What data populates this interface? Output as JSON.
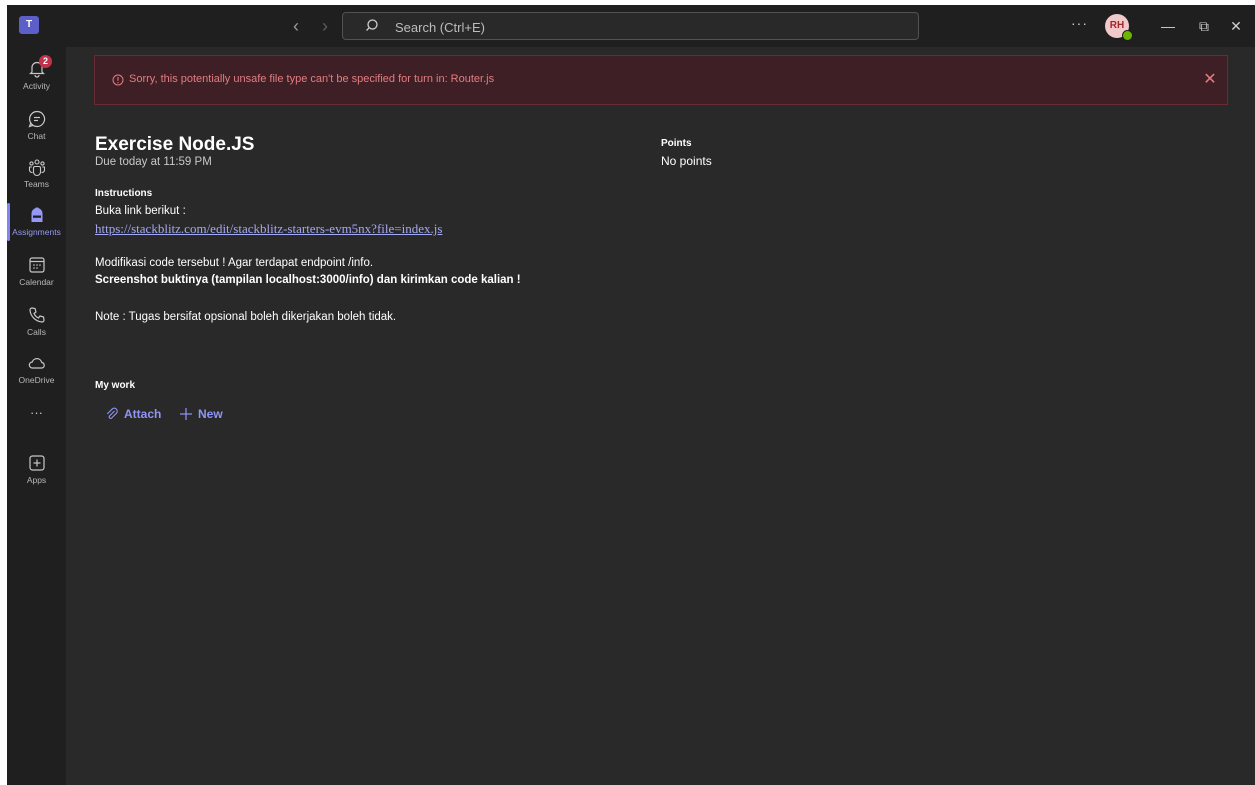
{
  "titlebar": {
    "app_logo": "T",
    "search_placeholder": "Search (Ctrl+E)",
    "more_label": "···",
    "avatar_initials": "RH",
    "minimize": "—",
    "maximize": "⧉",
    "close": "✕"
  },
  "rail": {
    "activity_label": "Activity",
    "activity_badge": "2",
    "chat_label": "Chat",
    "teams_label": "Teams",
    "assignments_label": "Assignments",
    "calendar_label": "Calendar",
    "calls_label": "Calls",
    "onedrive_label": "OneDrive",
    "more_label": "···",
    "apps_label": "Apps"
  },
  "banner": {
    "message": "Sorry, this potentially unsafe file type can't be specified for turn in: Router.js",
    "close": "✕"
  },
  "assignment": {
    "title": "Exercise Node.JS",
    "due": "Due today at 11:59 PM",
    "points_heading": "Points",
    "points_value": "No points",
    "instructions_heading": "Instructions",
    "line1": "Buka link berikut :",
    "link": "https://stackblitz.com/edit/stackblitz-starters-evm5nx?file=index.js",
    "line3": "Modifikasi code tersebut ! Agar terdapat endpoint /info.",
    "line4": "Screenshot buktinya (tampilan localhost:3000/info) dan kirimkan code kalian !",
    "line5": "Note : Tugas bersifat opsional boleh dikerjakan boleh tidak."
  },
  "mywork": {
    "heading": "My work",
    "attach_label": "Attach",
    "new_label": "New"
  },
  "colors": {
    "accent": "#7f85f5",
    "error_text": "#e37d80",
    "background": "#292929"
  }
}
